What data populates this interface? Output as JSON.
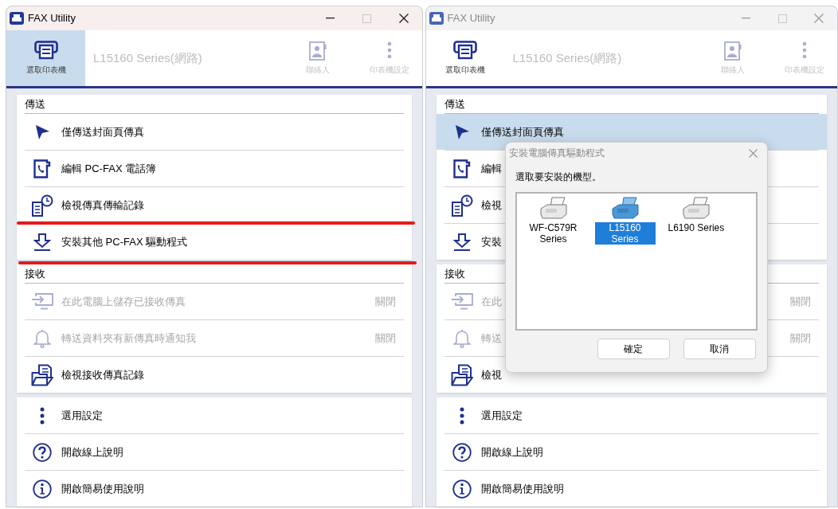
{
  "windows": [
    {
      "title": "FAX Utility",
      "focused": true,
      "toolbar": {
        "select_printer": {
          "label": "選取印表機",
          "selected": true
        },
        "printer_name": "L15160 Series(網路)",
        "contacts": "聯絡人",
        "printer_settings": "印表機設定"
      },
      "sections": [
        {
          "heading": "傳送",
          "items": [
            {
              "kind": "send",
              "label": "僅傳送封面頁傳真",
              "disabled": false,
              "selected": false,
              "marked": false
            },
            {
              "kind": "phonebook",
              "label": "編輯 PC-FAX 電話簿",
              "disabled": false,
              "selected": false,
              "marked": false
            },
            {
              "kind": "log",
              "label": "檢視傳真傳輸記錄",
              "disabled": false,
              "selected": false,
              "marked": false
            },
            {
              "kind": "download",
              "label": "安裝其他 PC-FAX 驅動程式",
              "disabled": false,
              "selected": false,
              "marked": true
            }
          ]
        },
        {
          "heading": "接收",
          "items": [
            {
              "kind": "save",
              "label": "在此電腦上儲存已接收傳真",
              "status": "關閉",
              "disabled": true,
              "selected": false,
              "marked": false
            },
            {
              "kind": "bell",
              "label": "轉送資料夾有新傳真時通知我",
              "status": "關閉",
              "disabled": true,
              "selected": false,
              "marked": false
            },
            {
              "kind": "folder",
              "label": "檢視接收傳真記錄",
              "disabled": false,
              "selected": false,
              "marked": false
            }
          ]
        },
        {
          "items": [
            {
              "kind": "dots",
              "label": "選用設定",
              "disabled": false,
              "selected": false,
              "marked": false
            },
            {
              "kind": "help",
              "label": "開啟線上說明",
              "disabled": false,
              "selected": false,
              "marked": false
            },
            {
              "kind": "info",
              "label": "開啟簡易使用說明",
              "disabled": false,
              "selected": false,
              "marked": false
            }
          ]
        }
      ]
    },
    {
      "title": "FAX Utility",
      "focused": false,
      "toolbar": {
        "select_printer": {
          "label": "選取印表機",
          "selected": false
        },
        "printer_name": "L15160 Series(網路)",
        "contacts": "聯絡人",
        "printer_settings": "印表機設定"
      },
      "sections": [
        {
          "heading": "傳送",
          "items": [
            {
              "kind": "send",
              "label": "僅傳送封面頁傳真",
              "disabled": false,
              "selected": true,
              "marked": false
            },
            {
              "kind": "phonebook",
              "label": "編輯",
              "disabled": false,
              "selected": false,
              "marked": false
            },
            {
              "kind": "log",
              "label": "檢視",
              "disabled": false,
              "selected": false,
              "marked": false
            },
            {
              "kind": "download",
              "label": "安裝",
              "disabled": false,
              "selected": false,
              "marked": false
            }
          ]
        },
        {
          "heading": "接收",
          "items": [
            {
              "kind": "save",
              "label": "在此",
              "status": "關閉",
              "disabled": true,
              "selected": false,
              "marked": false
            },
            {
              "kind": "bell",
              "label": "轉送",
              "status": "關閉",
              "disabled": true,
              "selected": false,
              "marked": false
            },
            {
              "kind": "folder",
              "label": "檢視",
              "disabled": false,
              "selected": false,
              "marked": false
            }
          ]
        },
        {
          "items": [
            {
              "kind": "dots",
              "label": "選用設定",
              "disabled": false,
              "selected": false,
              "marked": false
            },
            {
              "kind": "help",
              "label": "開啟線上說明",
              "disabled": false,
              "selected": false,
              "marked": false
            },
            {
              "kind": "info",
              "label": "開啟簡易使用說明",
              "disabled": false,
              "selected": false,
              "marked": false
            }
          ]
        }
      ],
      "dialog": {
        "title": "安裝電腦傳真驅動程式",
        "prompt": "選取要安裝的機型。",
        "models": [
          {
            "label": "WF-C579R Series",
            "selected": false
          },
          {
            "label": "L15160 Series",
            "selected": true
          },
          {
            "label": "L6190 Series",
            "selected": false
          }
        ],
        "buttons": [
          "確定",
          "取消"
        ]
      }
    }
  ]
}
